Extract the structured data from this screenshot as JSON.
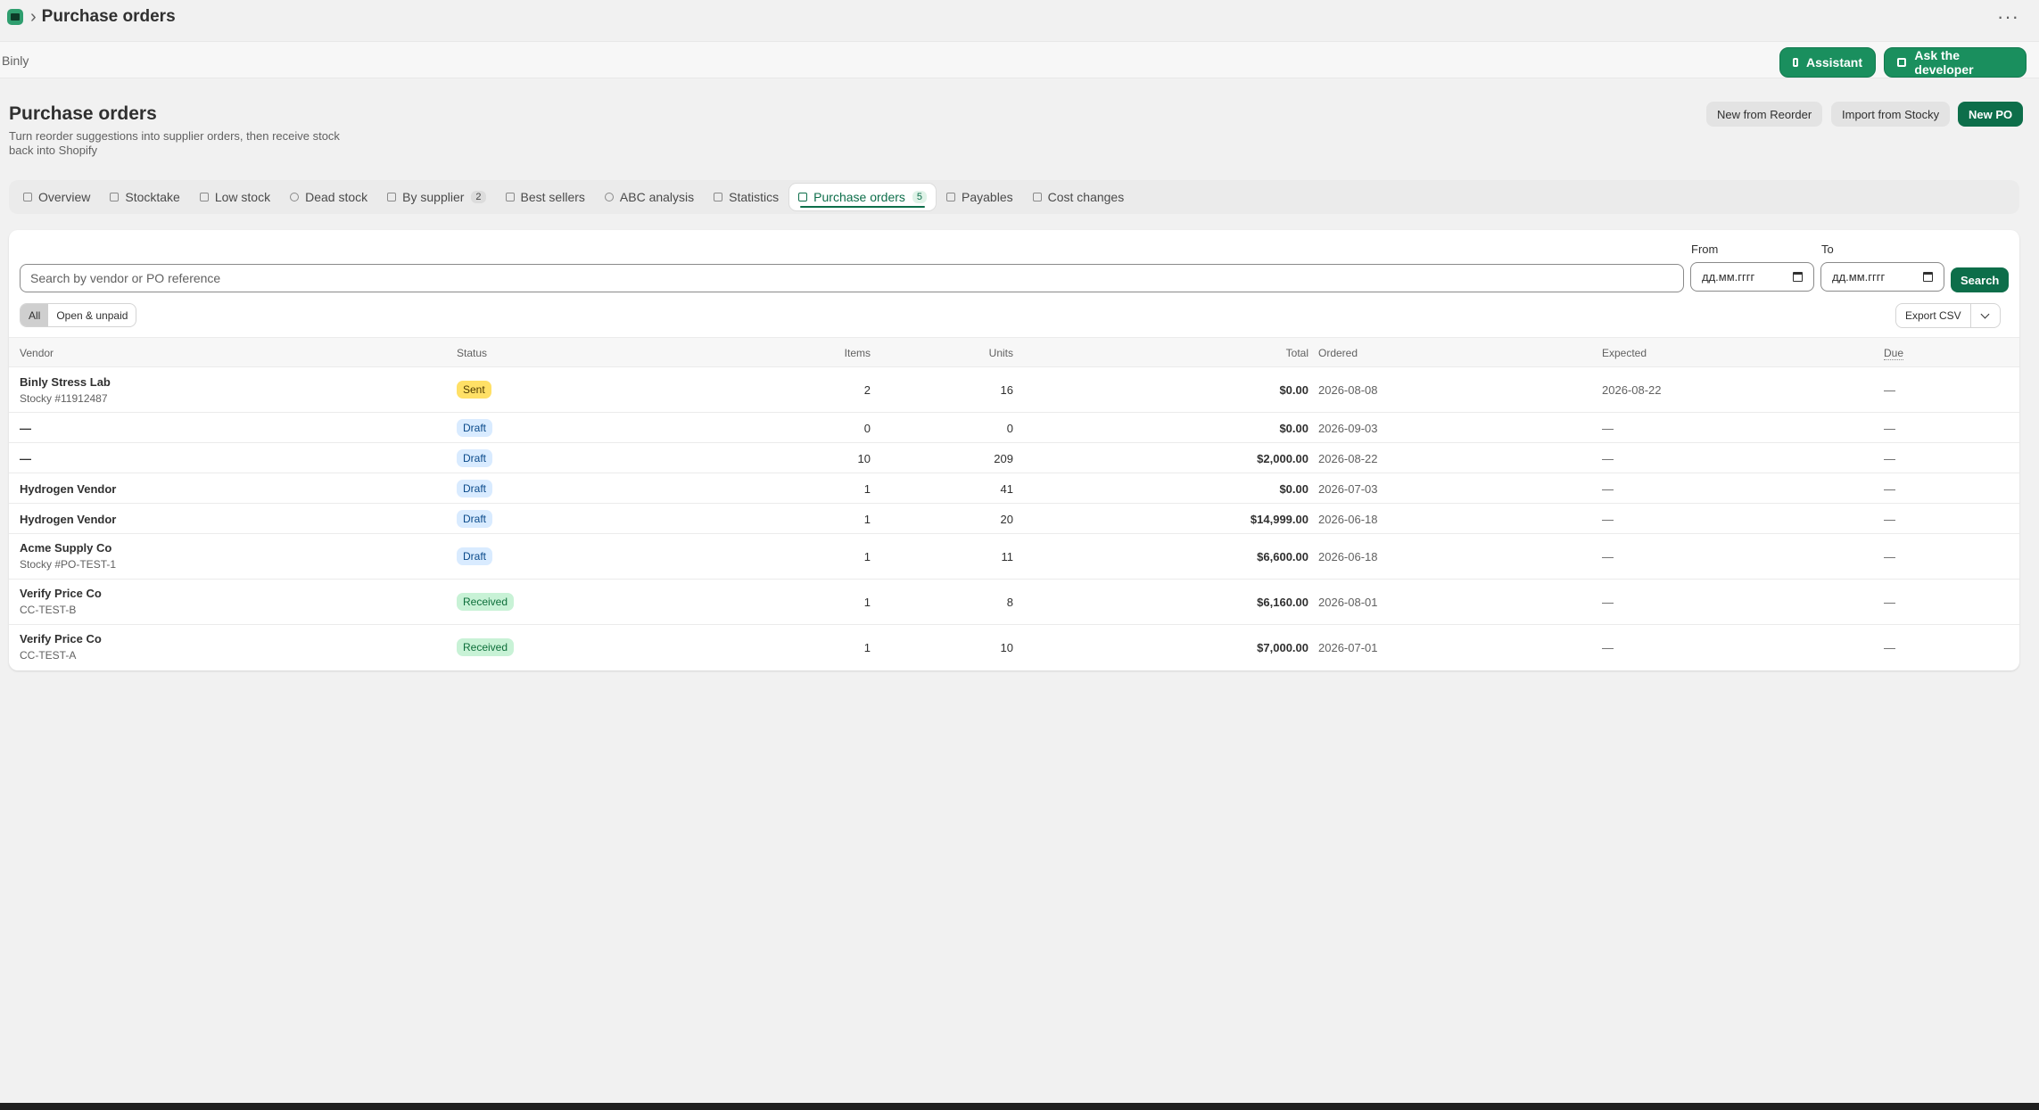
{
  "topbar": {
    "breadcrumb_sep": "›",
    "page": "Purchase orders",
    "more": "···",
    "app_icon": "app-icon"
  },
  "app": {
    "name": "Binly",
    "assistant_label": "Assistant",
    "developer_label": "Ask the developer",
    "accent": "#1a8f5e"
  },
  "page": {
    "title": "Purchase orders",
    "subtitle": "Turn reorder suggestions into supplier orders, then receive stock back into Shopify",
    "actions": {
      "reorder": "New from Reorder",
      "stocky": "Import from Stocky",
      "new_po": "New PO"
    }
  },
  "tabs": [
    {
      "label": "Overview",
      "icon": "grid-icon"
    },
    {
      "label": "Stocktake",
      "icon": "clipboard-icon"
    },
    {
      "label": "Low stock",
      "icon": "warning-icon"
    },
    {
      "label": "Dead stock",
      "icon": "clock-icon"
    },
    {
      "label": "By supplier",
      "icon": "store-icon",
      "badge": "2"
    },
    {
      "label": "Best sellers",
      "icon": "bar-chart-icon"
    },
    {
      "label": "ABC analysis",
      "icon": "pie-chart-icon"
    },
    {
      "label": "Statistics",
      "icon": "line-chart-icon"
    },
    {
      "label": "Purchase orders",
      "icon": "document-icon",
      "badge": "5",
      "active": true
    },
    {
      "label": "Payables",
      "icon": "card-icon"
    },
    {
      "label": "Cost changes",
      "icon": "trend-icon"
    }
  ],
  "filters": {
    "search_placeholder": "Search by vendor or PO reference",
    "from_label": "From",
    "to_label": "To",
    "date_placeholder": "дд.мм.гггг",
    "search_button": "Search",
    "segments": [
      "All",
      "Open & unpaid"
    ],
    "selected_segment": "All",
    "export_label": "Export CSV"
  },
  "table": {
    "columns": [
      "Vendor",
      "Status",
      "Items",
      "Units",
      "Total",
      "Ordered",
      "Expected",
      "Due"
    ],
    "rows": [
      {
        "vendor": "Binly Stress Lab",
        "ref": "Stocky #11912487",
        "status": "Sent",
        "items": "2",
        "units": "16",
        "total": "$0.00",
        "ordered": "2026-08-08",
        "expected": "2026-08-22",
        "due": "—"
      },
      {
        "vendor": "—",
        "ref": "",
        "status": "Draft",
        "items": "0",
        "units": "0",
        "total": "$0.00",
        "ordered": "2026-09-03",
        "expected": "—",
        "due": "—"
      },
      {
        "vendor": "—",
        "ref": "",
        "status": "Draft",
        "items": "10",
        "units": "209",
        "total": "$2,000.00",
        "ordered": "2026-08-22",
        "expected": "—",
        "due": "—"
      },
      {
        "vendor": "Hydrogen Vendor",
        "ref": "",
        "status": "Draft",
        "items": "1",
        "units": "41",
        "total": "$0.00",
        "ordered": "2026-07-03",
        "expected": "—",
        "due": "—"
      },
      {
        "vendor": "Hydrogen Vendor",
        "ref": "",
        "status": "Draft",
        "items": "1",
        "units": "20",
        "total": "$14,999.00",
        "ordered": "2026-06-18",
        "expected": "—",
        "due": "—"
      },
      {
        "vendor": "Acme Supply Co",
        "ref": "Stocky #PO-TEST-1",
        "status": "Draft",
        "items": "1",
        "units": "11",
        "total": "$6,600.00",
        "ordered": "2026-06-18",
        "expected": "—",
        "due": "—"
      },
      {
        "vendor": "Verify Price Co",
        "ref": "CC-TEST-B",
        "status": "Received",
        "items": "1",
        "units": "8",
        "total": "$6,160.00",
        "ordered": "2026-08-01",
        "expected": "—",
        "due": "—"
      },
      {
        "vendor": "Verify Price Co",
        "ref": "CC-TEST-A",
        "status": "Received",
        "items": "1",
        "units": "10",
        "total": "$7,000.00",
        "ordered": "2026-07-01",
        "expected": "—",
        "due": "—"
      }
    ]
  }
}
